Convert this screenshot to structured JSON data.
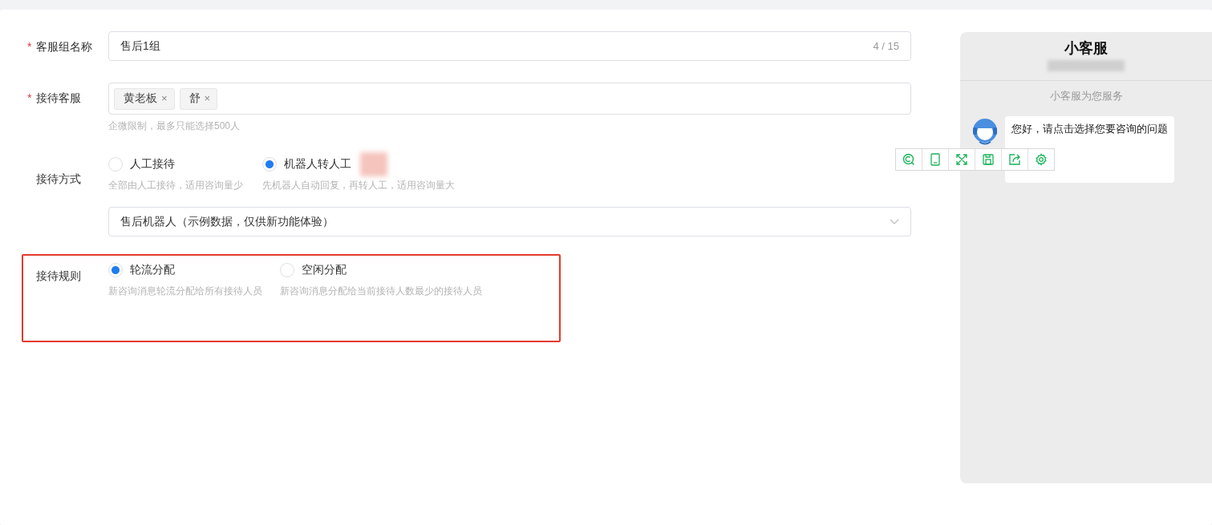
{
  "group_name": {
    "required_mark": "*",
    "label": "客服组名称",
    "value": "售后1组",
    "counter": "4 / 15"
  },
  "agents": {
    "required_mark": "*",
    "label": "接待客服",
    "tags": [
      {
        "name": "黄老板",
        "remove": "×"
      },
      {
        "name": "舒",
        "remove": "×"
      }
    ],
    "hint": "企微限制，最多只能选择500人"
  },
  "reception_mode": {
    "label": "接待方式",
    "options": [
      {
        "label": "人工接待",
        "description": "全部由人工接待，适用咨询量少",
        "selected": false
      },
      {
        "label": "机器人转人工",
        "description": "先机器人自动回复，再转人工，适用咨询量大",
        "selected": true
      }
    ],
    "robot_select": {
      "value": "售后机器人（示例数据，仅供新功能体验）"
    }
  },
  "reception_rule": {
    "label": "接待规则",
    "highlighted": true,
    "options": [
      {
        "label": "轮流分配",
        "description": "新咨询消息轮流分配给所有接待人员",
        "selected": true
      },
      {
        "label": "空闲分配",
        "description": "新咨询消息分配给当前接待人数最少的接待人员",
        "selected": false
      }
    ]
  },
  "preview": {
    "title": "小客服",
    "subtitle": "小客服为您服务",
    "message": "您好，请点击选择您要咨询的问题"
  }
}
